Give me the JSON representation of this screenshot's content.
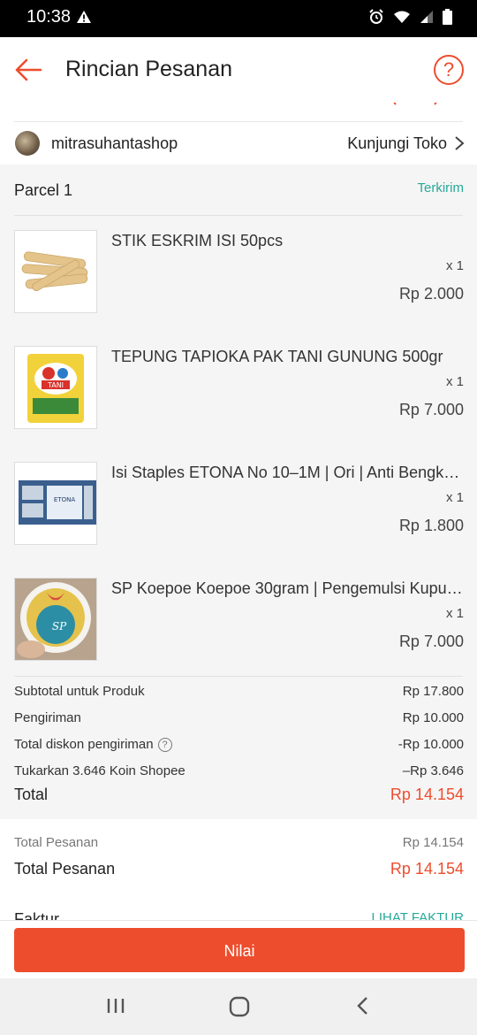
{
  "status_bar": {
    "time": "10:38"
  },
  "header": {
    "title": "Rincian Pesanan"
  },
  "shop": {
    "name": "mitrasuhantashop",
    "visit_label": "Kunjungi Toko"
  },
  "parcel": {
    "title": "Parcel 1",
    "status": "Terkirim",
    "items": [
      {
        "name": "STIK ESKRIM ISI 50pcs",
        "qty": "x 1",
        "price": "Rp 2.000"
      },
      {
        "name": "TEPUNG TAPIOKA PAK TANI GUNUNG 500gr",
        "qty": "x 1",
        "price": "Rp 7.000"
      },
      {
        "name": "Isi Staples ETONA No 10–1M | Ori | Anti Bengko...",
        "qty": "x 1",
        "price": "Rp 1.800"
      },
      {
        "name": "SP Koepoe Koepoe 30gram | Pengemulsi Kupu ...",
        "qty": "x 1",
        "price": "Rp 7.000"
      }
    ],
    "thumb_text": {
      "p2_brand": "TANI",
      "p3_label": "ETONA",
      "p4_brand": "SP"
    }
  },
  "summary": {
    "subtotal": {
      "label": "Subtotal untuk Produk",
      "value": "Rp 17.800"
    },
    "shipping": {
      "label": "Pengiriman",
      "value": "Rp 10.000"
    },
    "shipping_discount": {
      "label": "Total diskon pengiriman",
      "value": "-Rp 10.000"
    },
    "coins": {
      "label": "Tukarkan 3.646 Koin Shopee",
      "value": "–Rp 3.646"
    },
    "total": {
      "label": "Total",
      "value": "Rp 14.154"
    }
  },
  "orders": {
    "total_small": {
      "label": "Total Pesanan",
      "value": "Rp 14.154"
    },
    "total_big": {
      "label": "Total Pesanan",
      "value": "Rp 14.154"
    },
    "invoice": {
      "label": "Faktur",
      "link": "LIHAT FAKTUR"
    }
  },
  "action": {
    "rate_button": "Nilai"
  },
  "icons": {
    "back": "arrow-left-icon",
    "help": "question-circle-icon",
    "chevron": "chevron-right-icon",
    "nav_recent": "recent-apps-icon",
    "nav_home": "home-icon",
    "nav_back": "nav-back-icon"
  },
  "colors": {
    "brand": "#ee4d2d",
    "status_green": "#26aa99",
    "background": "#f5f5f5"
  }
}
